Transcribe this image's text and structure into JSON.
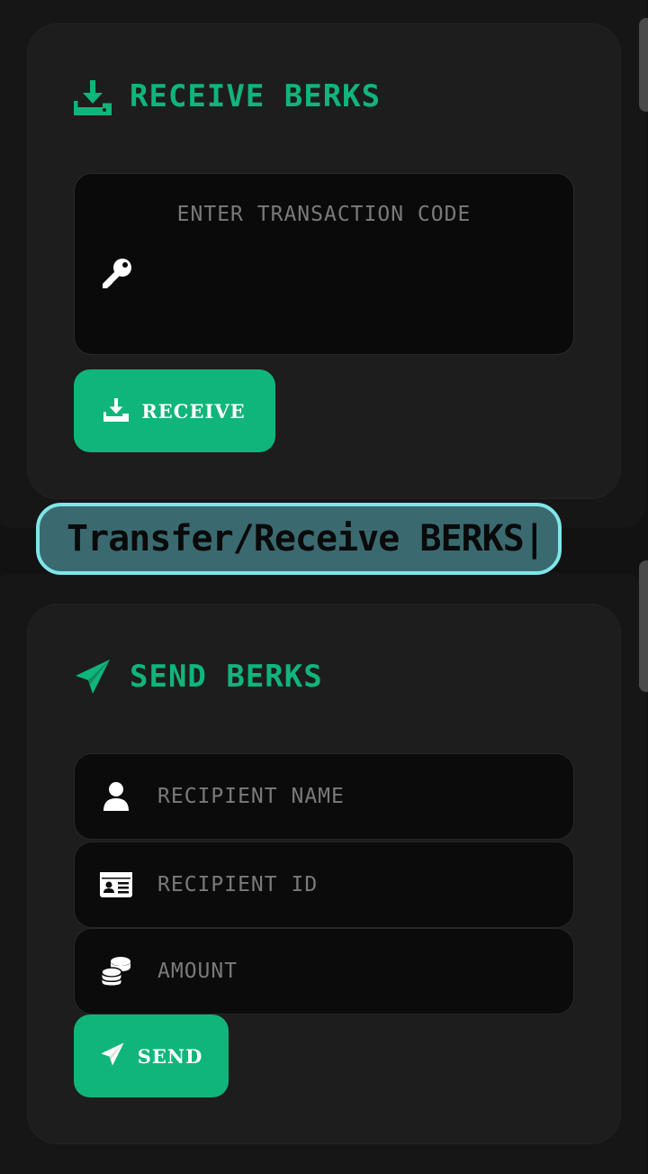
{
  "receive": {
    "title": "RECEIVE BERKS",
    "title_icon": "download-tray-icon",
    "code_placeholder": "ENTER TRANSACTION CODE",
    "code_icon": "key-icon",
    "button_label": "RECEIVE",
    "button_icon": "download-tray-icon"
  },
  "banner": {
    "text": "Transfer/Receive BERKS|"
  },
  "send": {
    "title": "SEND BERKS",
    "title_icon": "paper-plane-icon",
    "fields": [
      {
        "placeholder": "RECIPIENT NAME",
        "icon": "user-icon"
      },
      {
        "placeholder": "RECIPIENT ID",
        "icon": "id-card-icon"
      },
      {
        "placeholder": "AMOUNT",
        "icon": "coins-icon"
      }
    ],
    "button_label": "SEND",
    "button_icon": "paper-plane-icon"
  },
  "colors": {
    "accent": "#10b57b",
    "background": "#121212",
    "card": "#1d1d1d",
    "input": "#0a0a0a",
    "banner_bg": "#3a6a70",
    "banner_border": "#7fe6ea"
  }
}
